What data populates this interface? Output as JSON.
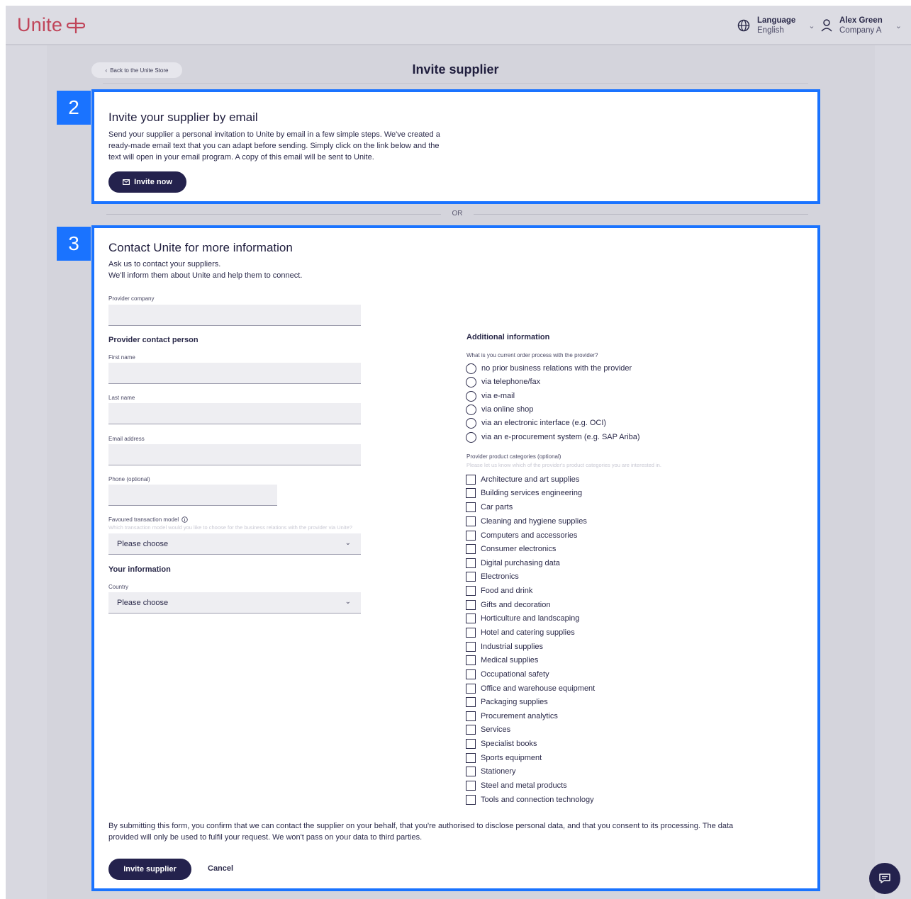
{
  "header": {
    "logo_text": "Unite",
    "language_label": "Language",
    "language_value": "English",
    "user_name": "Alex Green",
    "user_company": "Company A"
  },
  "page": {
    "back_link": "Back to the Unite Store",
    "title": "Invite supplier"
  },
  "invite_email": {
    "badge": "2",
    "heading": "Invite your supplier by email",
    "body_lines": [
      "Send your supplier a personal invitation to Unite by email in a few simple steps. We've created a",
      "ready-made email text that you can adapt before sending. Simply click on the link below and the",
      "text will open in your email program. A copy of this email will be sent to Unite."
    ],
    "button_label": "Invite now"
  },
  "divider": {
    "label": "OR"
  },
  "contact_form": {
    "badge": "3",
    "heading": "Contact Unite for more information",
    "intro_lines": [
      "Ask us to contact your suppliers.",
      "We'll inform them about Unite and help them to connect."
    ],
    "provider_company_label": "Provider company",
    "contact_person_heading": "Provider contact person",
    "first_name_label": "First name",
    "last_name_label": "Last name",
    "email_label": "Email address",
    "phone_label": "Phone (optional)",
    "transaction_model_label": "Favoured transaction model",
    "transaction_model_hint": "Which transaction model would you like to choose for the business relations with the provider via Unite?",
    "transaction_model_value": "Please choose",
    "your_info_heading": "Your information",
    "country_label": "Country",
    "country_value": "Please choose",
    "additional_heading": "Additional information",
    "order_process_question": "What is you current order process with the provider?",
    "order_process_options": [
      "no prior business relations with the provider",
      "via telephone/fax",
      "via e-mail",
      "via online shop",
      "via an electronic interface (e.g. OCI)",
      "via an e-procurement system (e.g. SAP Ariba)"
    ],
    "categories_label": "Provider product categories (optional)",
    "categories_hint": "Please let us know which of the provider's product categories you are interested in.",
    "categories": [
      "Architecture and art supplies",
      "Building services engineering",
      "Car parts",
      "Cleaning and hygiene supplies",
      "Computers and accessories",
      "Consumer electronics",
      "Digital purchasing data",
      "Electronics",
      "Food and drink",
      "Gifts and decoration",
      "Horticulture and landscaping",
      "Hotel and catering supplies",
      "Industrial supplies",
      "Medical supplies",
      "Occupational safety",
      "Office and warehouse equipment",
      "Packaging supplies",
      "Procurement analytics",
      "Services",
      "Specialist books",
      "Sports equipment",
      "Stationery",
      "Steel and metal products",
      "Tools and connection technology"
    ],
    "consent_lines": [
      "By submitting this form, you confirm that we can contact the supplier on your behalf, that you're authorised to disclose personal data, and that you consent to its processing. The data",
      "provided will only be used to fulfil your request. We won't pass on your data to third parties."
    ],
    "submit_label": "Invite supplier",
    "cancel_label": "Cancel"
  },
  "colors": {
    "brand": "#c0455a",
    "primary_button": "#24224d",
    "highlight": "#1a73ff"
  }
}
